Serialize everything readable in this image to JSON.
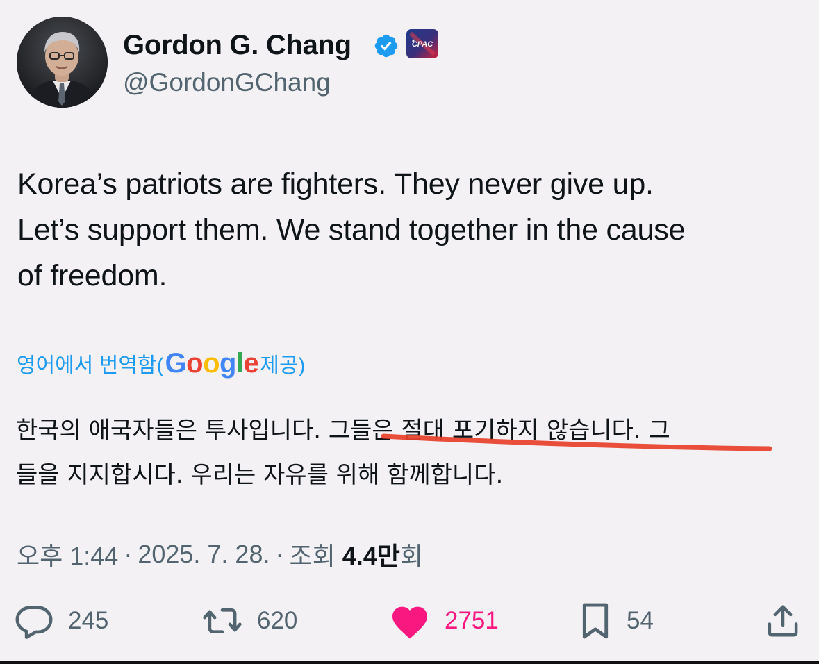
{
  "author": {
    "display_name": "Gordon G. Chang",
    "handle": "@GordonGChang",
    "org_badge_text": "CPAC",
    "accent_color": "#1d9bf0"
  },
  "tweet": {
    "text": "Korea’s patriots are fighters. They never give up.\nLet’s support them. We stand together in the cause\nof freedom."
  },
  "translation": {
    "prefix": "영어에서 번역함(",
    "provider": "Google",
    "suffix": " 제공)",
    "line1_start": "한국의 애국자들은 투사입니다. ",
    "line1_underlined": "그들은 절대 포기하지 않습니다.",
    "line1_end": " 그",
    "line2": "들을 지지합시다. 우리는 자유를 위해 함께합니다."
  },
  "meta": {
    "time": "오후 1:44",
    "separator": "·",
    "date": "2025. 7. 28.",
    "views_label": "조회",
    "views_count": "4.4만",
    "views_suffix": "회"
  },
  "actions": {
    "replies": "245",
    "reposts": "620",
    "likes": "2751",
    "bookmarks": "54",
    "like_color": "#f91880"
  },
  "icons": [
    "verified-icon",
    "reply-icon",
    "repost-icon",
    "heart-icon",
    "bookmark-icon",
    "share-icon"
  ]
}
